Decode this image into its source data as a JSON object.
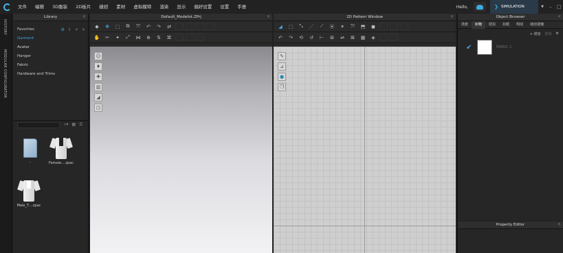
{
  "menu": {
    "items": [
      "文件",
      "编辑",
      "3D服装",
      "2D板片",
      "缝纫",
      "素材",
      "虚拟模特",
      "渲染",
      "显示",
      "偏好设置",
      "设置",
      "手册"
    ],
    "hello": "Hello,",
    "simulation": "SIMULATION"
  },
  "sidebar": {
    "history": "HISTORY",
    "modular": "MODULAR CONFIGURATOR"
  },
  "library": {
    "title": "Library",
    "items": [
      "Favorites",
      "Garment",
      "Avatar",
      "Hanger",
      "Fabric",
      "Hardware and Trims"
    ],
    "active_index": 1,
    "thumbs": [
      {
        "label": "..",
        "icon": "folder-icon"
      },
      {
        "label": "Female....zpac",
        "icon": "shirt-icon"
      },
      {
        "label": "Male_T....zpac",
        "icon": "shirt-icon"
      }
    ]
  },
  "window3d": {
    "title": "Default_Modelist.ZPrj"
  },
  "window2d": {
    "title": "2D Pattern Window"
  },
  "objectBrowser": {
    "title": "Object Browser",
    "tabs": [
      "场景",
      "织物",
      "纽扣",
      "扣眼",
      "明线",
      "缝纫褶皱"
    ],
    "active_tab": 1,
    "add_label": "+ 增加",
    "copy_label": "复制",
    "fabric_name": "FABRIC 1"
  },
  "propertyEditor": {
    "title": "Property Editor"
  },
  "colors": {
    "accent": "#3fa9e0"
  }
}
